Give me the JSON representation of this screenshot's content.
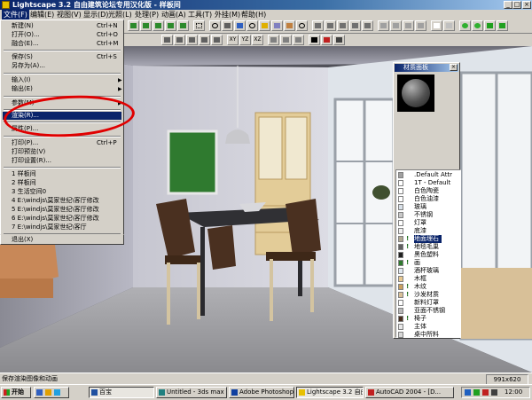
{
  "window": {
    "title": "Lightscape 3.2 自由建筑论坛专用汉化版 - 样板间"
  },
  "menubar": {
    "items": [
      "文件(F)",
      "编辑(E)",
      "视图(V)",
      "显示(D)",
      "光照(L)",
      "处理(P)",
      "动画(A)",
      "工具(T)",
      "外挂(M)",
      "帮助(H)"
    ]
  },
  "file_menu": {
    "items": [
      {
        "label": "新建(N)",
        "shortcut": "Ctrl+N"
      },
      {
        "label": "打开(O)...",
        "shortcut": "Ctrl+O"
      },
      {
        "label": "融合(E)...",
        "shortcut": "Ctrl+M"
      },
      {
        "label": "保存(S)",
        "shortcut": "Ctrl+S"
      },
      {
        "label": "另存为(A)..."
      },
      {
        "label": "输入(I)",
        "submenu": true
      },
      {
        "label": "输出(E)",
        "submenu": true
      },
      {
        "label": "参数(M)",
        "submenu": true
      },
      {
        "label": "渲染(R)...",
        "selected": true
      },
      {
        "label": "属性(P)..."
      },
      {
        "label": "打印(P)...",
        "shortcut": "Ctrl+P"
      },
      {
        "label": "打印预览(V)"
      },
      {
        "label": "打印设置(R)..."
      },
      {
        "label": "1 样板间"
      },
      {
        "label": "2 样板间"
      },
      {
        "label": "3 生活空间0"
      },
      {
        "label": "4 E:\\windjs\\莫家世纪\\客厅修改"
      },
      {
        "label": "5 E:\\windjs\\莫家世纪\\客厅修改"
      },
      {
        "label": "6 E:\\windjs\\莫家世纪\\客厅修改"
      },
      {
        "label": "7 E:\\windjs\\莫家世纪\\客厅"
      },
      {
        "label": "退出(X)"
      }
    ]
  },
  "toolbar2": {
    "labels": [
      "XY",
      "YZ",
      "XZ"
    ]
  },
  "materials_panel": {
    "title": "材质面板",
    "items": [
      {
        "name": ".Default Attr",
        "color": "#a0a0a0",
        "lit": false
      },
      {
        "name": "1T - Default",
        "color": "#ffffff",
        "lit": false
      },
      {
        "name": "白色陶瓷",
        "color": "#ffffff",
        "lit": false
      },
      {
        "name": "白色油漆",
        "color": "#ffffff",
        "lit": false
      },
      {
        "name": "玻璃",
        "color": "#d8e0e8",
        "lit": false
      },
      {
        "name": "不锈钢",
        "color": "#c8c8c8",
        "lit": false
      },
      {
        "name": "灯罩",
        "color": "#ffffff",
        "lit": false
      },
      {
        "name": "底漆",
        "color": "#f0f0f0",
        "lit": false
      },
      {
        "name": "地面理石",
        "color": "#b0a890",
        "lit": true,
        "selected": true
      },
      {
        "name": "地毯毛巢",
        "color": "#606060",
        "lit": true
      },
      {
        "name": "黑色塑料",
        "color": "#202020",
        "lit": false
      },
      {
        "name": "画",
        "color": "#2f7a2f",
        "lit": true
      },
      {
        "name": "酒杯玻璃",
        "color": "#e0e8f0",
        "lit": false
      },
      {
        "name": "木框",
        "color": "#e8c890",
        "lit": false
      },
      {
        "name": "木纹",
        "color": "#c8a060",
        "lit": true
      },
      {
        "name": "沙发材质",
        "color": "#d8c098",
        "lit": true
      },
      {
        "name": "新料灯罩",
        "color": "#ffffff",
        "lit": false
      },
      {
        "name": "亚面不锈钢",
        "color": "#b8b8b8",
        "lit": false
      },
      {
        "name": "椅子",
        "color": "#4a3020",
        "lit": true
      },
      {
        "name": "主体",
        "color": "#e8e8e8",
        "lit": false
      },
      {
        "name": "桌中所料",
        "color": "#d8d8d8",
        "lit": false
      }
    ]
  },
  "status": {
    "text": "保存渲染图像和动画",
    "coords": "991x620"
  },
  "taskbar": {
    "start": "开始",
    "tasks": [
      "百宝",
      "Untitled - 3ds max ...",
      "Adobe Photoshop",
      "Lightscape 3.2 自由...",
      "AutoCAD 2004 - [D..."
    ],
    "clock": "12:00"
  },
  "colors": {
    "selection": "#0a246a",
    "annotation": "#e00000",
    "chrome": "#d4d0c8"
  }
}
